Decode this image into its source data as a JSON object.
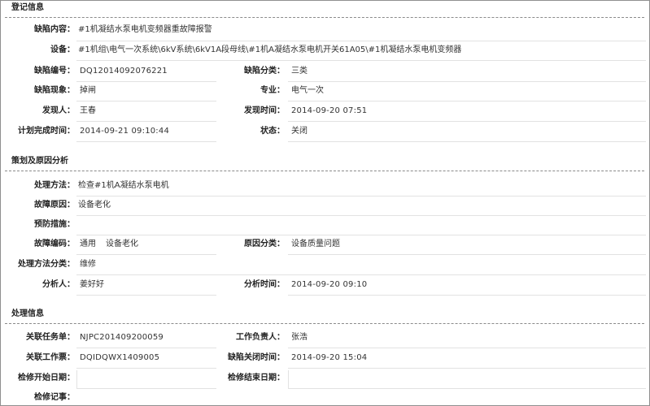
{
  "section1": {
    "title": "登记信息",
    "defect_content_label": "缺陷内容：",
    "defect_content": "#1机凝结水泵电机变频器重故障报警",
    "equipment_label": "设备：",
    "equipment": "#1机组\\电气一次系统\\6kV系统\\6kV1A段母线\\#1机A凝结水泵电机开关61A05\\#1机凝结水泵电机变频器",
    "defect_no_label": "缺陷编号：",
    "defect_no": "DQ12014092076221",
    "defect_class_label": "缺陷分类：",
    "defect_class": "三类",
    "phenomenon_label": "缺陷现象：",
    "phenomenon": "掉闸",
    "specialty_label": "专业：",
    "specialty": "电气一次",
    "finder_label": "发现人：",
    "finder": "王春",
    "found_time_label": "发现时间：",
    "found_time": "2014-09-20 07:51",
    "plan_time_label": "计划完成时间：",
    "plan_time": "2014-09-21 09:10:44",
    "status_label": "状态：",
    "status": "关闭"
  },
  "section2": {
    "title": "策划及原因分析",
    "method_label": "处理方法：",
    "method": "检查#1机A凝结水泵电机",
    "cause_label": "故障原因：",
    "cause": "设备老化",
    "prevent_label": "预防措施：",
    "prevent": "",
    "fault_code_label": "故障编码：",
    "fault_code_a": "通用",
    "fault_code_b": "设备老化",
    "cause_class_label": "原因分类：",
    "cause_class": "设备质量问题",
    "method_class_label": "处理方法分类：",
    "method_class": "维修",
    "analyst_label": "分析人：",
    "analyst": "姜好好",
    "analysis_time_label": "分析时间：",
    "analysis_time": "2014-09-20 09:10"
  },
  "section3": {
    "title": "处理信息",
    "task_label": "关联任务单：",
    "task": "NJPC201409200059",
    "leader_label": "工作负责人：",
    "leader": "张浩",
    "ticket_label": "关联工作票：",
    "ticket": "DQIDQWX1409005",
    "close_time_label": "缺陷关闭时间：",
    "close_time": "2014-09-20 15:04",
    "repair_start_label": "检修开始日期：",
    "repair_start": "",
    "repair_end_label": "检修结束日期：",
    "repair_end": "",
    "repair_record_label": "检修记事：",
    "repair_record": ""
  }
}
